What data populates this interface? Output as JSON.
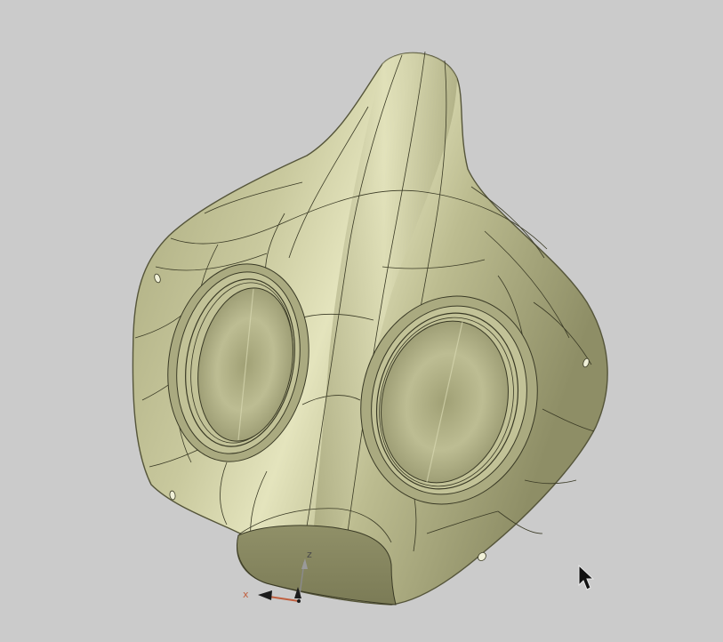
{
  "app": {
    "title": "",
    "background_color": "#cbcbcb"
  },
  "viewport": {
    "model": {
      "kind": "3d-mask-model",
      "surface_color": "#b9b98d",
      "edge_color": "#3a3a25"
    },
    "triad": {
      "x_label": "x",
      "z_label": "z",
      "x_color": "#c06040",
      "z_color": "#4a4a4a"
    },
    "cursor": {
      "icon": "mouse-pointer-icon"
    }
  }
}
